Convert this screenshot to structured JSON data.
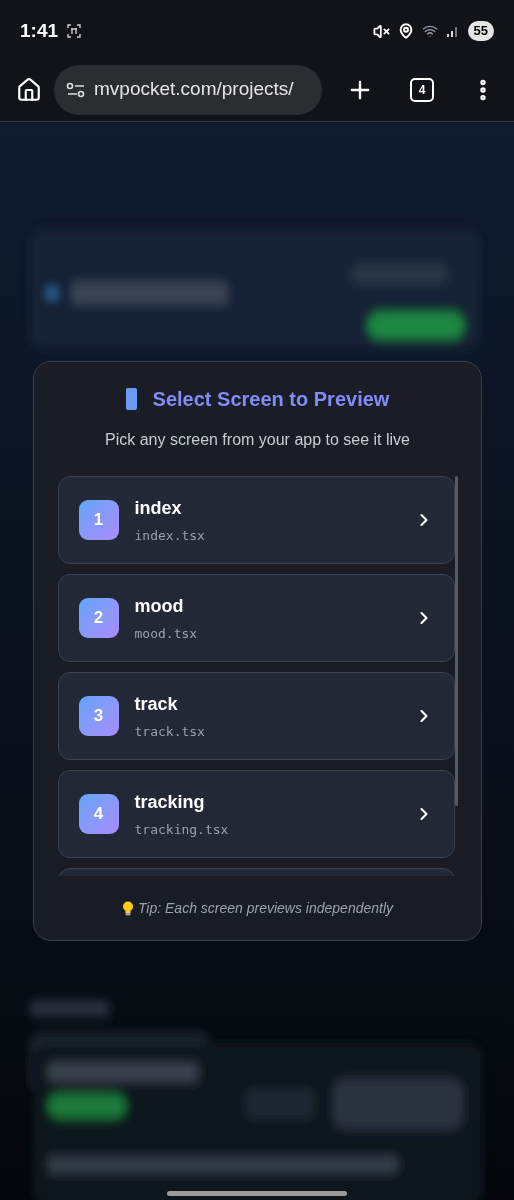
{
  "status_bar": {
    "time": "1:41",
    "battery": "55"
  },
  "browser": {
    "url": "mvpocket.com/projects/",
    "tab_count": "4"
  },
  "dialog": {
    "title": "Select Screen to Preview",
    "subtitle": "Pick any screen from your app to see it live",
    "screens": [
      {
        "number": "1",
        "name": "index",
        "file": "index.tsx"
      },
      {
        "number": "2",
        "name": "mood",
        "file": "mood.tsx"
      },
      {
        "number": "3",
        "name": "track",
        "file": "track.tsx"
      },
      {
        "number": "4",
        "name": "tracking",
        "file": "tracking.tsx"
      }
    ],
    "tip": "Tip: Each screen previews independently"
  }
}
